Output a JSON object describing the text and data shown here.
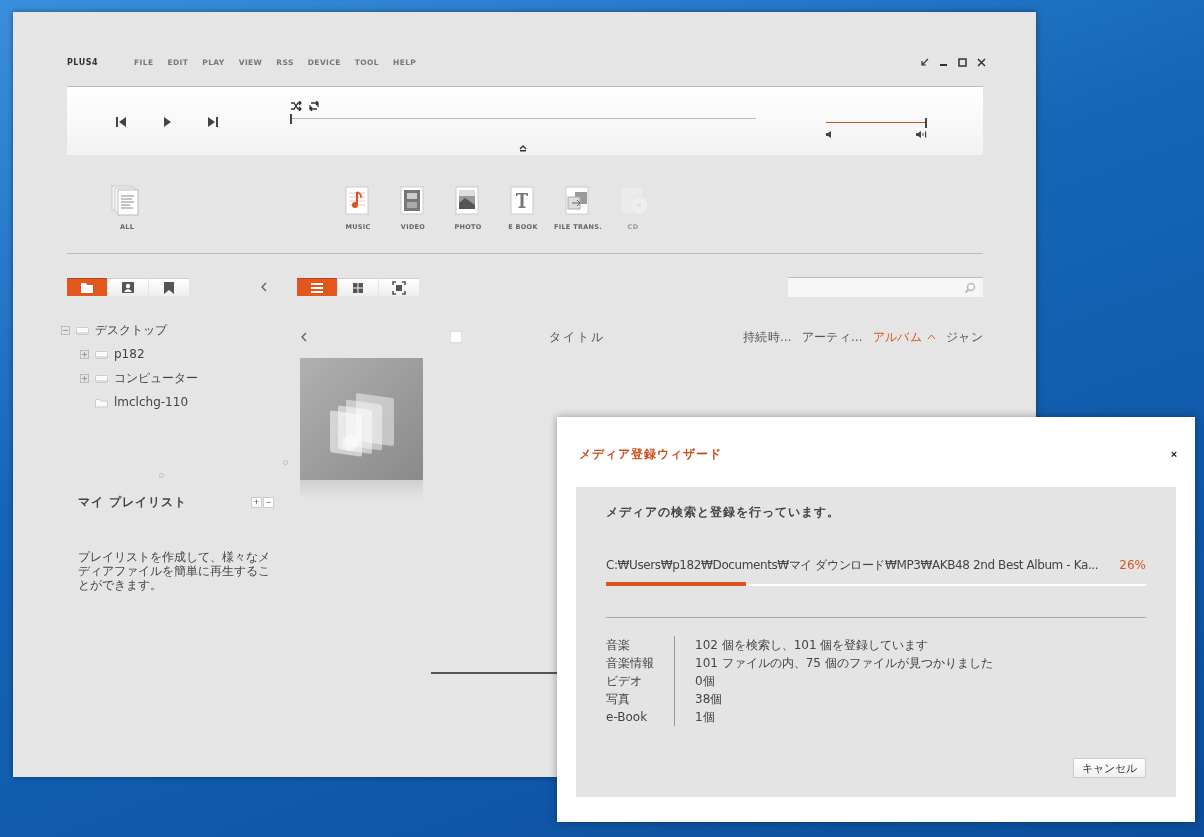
{
  "app": {
    "logo": "PLUS4",
    "menu": [
      "FILE",
      "EDIT",
      "PLAY",
      "VIEW",
      "RSS",
      "DEVICE",
      "TOOL",
      "HELP"
    ],
    "player": {
      "seek": {
        "level": 0
      },
      "volume": {
        "level": 1
      }
    },
    "categories": [
      {
        "kind": "all",
        "label": "ALL",
        "disabled": false
      },
      {
        "kind": "music",
        "label": "MUSIC",
        "disabled": false
      },
      {
        "kind": "video",
        "label": "VIDEO",
        "disabled": false
      },
      {
        "kind": "photo",
        "label": "PHOTO",
        "disabled": false
      },
      {
        "kind": "ebook",
        "label": "E BOOK",
        "disabled": false
      },
      {
        "kind": "transfer",
        "label": "FILE TRANS.",
        "disabled": false
      },
      {
        "kind": "cd",
        "label": "CD",
        "disabled": true
      }
    ],
    "source_tabs": [
      {
        "kind": "folder",
        "selected": true
      },
      {
        "kind": "person",
        "selected": false
      },
      {
        "kind": "bookmark",
        "selected": false
      }
    ],
    "view_tabs": [
      {
        "kind": "list",
        "selected": true
      },
      {
        "kind": "grid",
        "selected": false
      },
      {
        "kind": "fullscreen",
        "selected": false
      }
    ],
    "tree": [
      {
        "kind": "drive",
        "label": "デスクトップ",
        "expanded": true,
        "children": [
          {
            "kind": "drive",
            "label": "p182",
            "expanded": false
          },
          {
            "kind": "drive",
            "label": "コンピューター",
            "expanded": false
          },
          {
            "kind": "folder",
            "label": "lmclchg-110"
          }
        ]
      }
    ],
    "playlist": {
      "title": "マイ プレイリスト",
      "buttons": [
        "+",
        "−"
      ],
      "hint": "プレイリストを作成して、様々なメディアファイルを簡単に再生することができます。"
    },
    "list": {
      "select_all": {
        "checked": false
      },
      "title_column": "タイトル",
      "columns": [
        {
          "label": "持続時…",
          "sorted": false
        },
        {
          "label": "アーティ…",
          "sorted": false
        },
        {
          "label": "アルバム",
          "sorted": true
        },
        {
          "label": "ジャン",
          "sorted": false
        }
      ]
    }
  },
  "wizard": {
    "title": "メディア登録ウィザード",
    "close": "×",
    "status": "メディアの検索と登録を行っています。",
    "file": "C:₩Users₩p182₩Documents₩マイ ダウンロード₩MP3₩AKB48 2nd Best Album - Ka...",
    "percent": "26%",
    "level": 0.26,
    "stats": [
      {
        "label": "音楽",
        "value": "102 個を検索し、101 個を登録しています"
      },
      {
        "label": "音楽情報",
        "value": "101 ファイルの内、75 個のファイルが見つかりました"
      },
      {
        "label": "ビデオ",
        "value": "0個"
      },
      {
        "label": "写真",
        "value": "38個"
      },
      {
        "label": "e-Book",
        "value": "1個"
      }
    ],
    "cancel": "キャンセル"
  }
}
